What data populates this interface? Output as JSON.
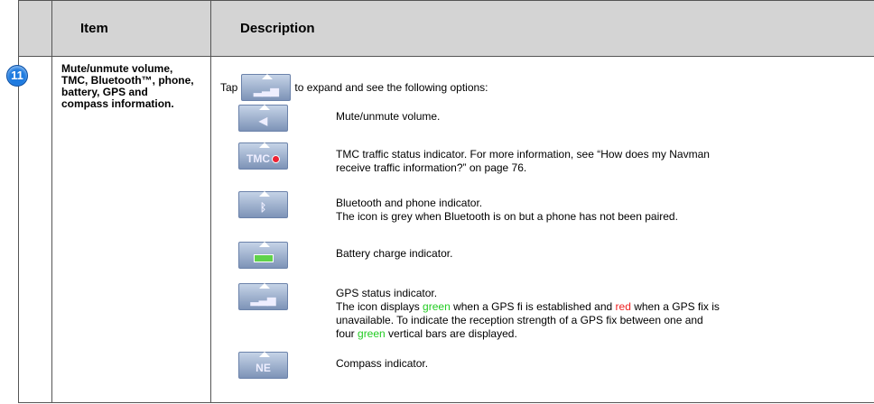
{
  "header": {
    "col_item": "Item",
    "col_description": "Description"
  },
  "row": {
    "number": "11",
    "item": "Mute/unmute volume, TMC, Bluetooth™, phone, battery, GPS and compass information.",
    "intro_before": "Tap",
    "intro_after": "to expand and see the following options:"
  },
  "entries": [
    {
      "icon": "speaker-icon",
      "icon_text": "◀",
      "lines": [
        "Mute/unmute volume."
      ]
    },
    {
      "icon": "tmc-icon",
      "icon_text": "TMC",
      "lines": [
        "TMC traffic status indicator. For more information, see “How does my Navman",
        "receive traffic information?” on page 76."
      ]
    },
    {
      "icon": "bluetooth-icon",
      "icon_text": "ᛒ",
      "lines": [
        "Bluetooth and phone indicator.",
        "The icon is grey when Bluetooth is on but a phone has not been paired."
      ]
    },
    {
      "icon": "battery-icon",
      "icon_text": "",
      "lines": [
        "Battery charge indicator."
      ]
    },
    {
      "icon": "gps-icon",
      "icon_text": "▂▃▅",
      "title": "GPS status indicator.",
      "l2_a": "The icon displays ",
      "l2_green": "green",
      "l2_b": " when a GPS fi is established and ",
      "l2_red": "red",
      "l2_c": " when a GPS fix is",
      "l3": "unavailable. To indicate the reception strength of a GPS fix between one and",
      "l4_a": "four ",
      "l4_green": "green",
      "l4_b": " vertical bars are displayed."
    },
    {
      "icon": "compass-icon",
      "icon_text": "NE",
      "lines": [
        "Compass indicator."
      ]
    }
  ],
  "colors": {
    "header_bg": "#d4d4d4",
    "green_text": "#22cc22",
    "red_text": "#ee2222",
    "badge": "#1e7be0"
  }
}
